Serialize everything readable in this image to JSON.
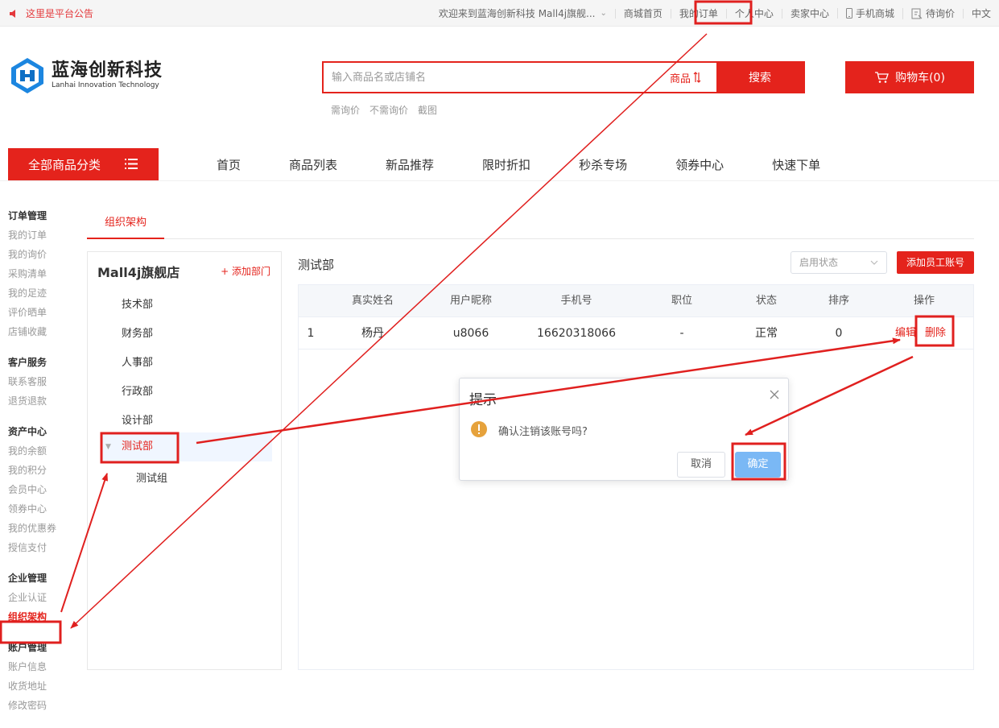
{
  "topbar": {
    "notice": "这里是平台公告",
    "welcome": "欢迎来到蓝海创新科技 Mall4j旗舰...",
    "links": [
      "商城首页",
      "我的订单",
      "个人中心",
      "卖家中心",
      "手机商城",
      "待询价",
      "中文"
    ]
  },
  "logo": {
    "cn": "蓝海创新科技",
    "en": "Lanhai Innovation Technology"
  },
  "search": {
    "placeholder": "输入商品名或店铺名",
    "type": "商品",
    "button": "搜索",
    "hot": [
      "需询价",
      "不需询价",
      "截图"
    ]
  },
  "cart": {
    "label": "购物车(0)"
  },
  "nav": {
    "all_categories": "全部商品分类",
    "items": [
      "首页",
      "商品列表",
      "新品推荐",
      "限时折扣",
      "秒杀专场",
      "领券中心",
      "快速下单"
    ]
  },
  "sidebar": [
    {
      "title": "订单管理",
      "items": [
        "我的订单",
        "我的询价",
        "采购清单",
        "我的足迹",
        "评价晒单",
        "店铺收藏"
      ]
    },
    {
      "title": "客户服务",
      "items": [
        "联系客服",
        "退货退款"
      ]
    },
    {
      "title": "资产中心",
      "items": [
        "我的余额",
        "我的积分",
        "会员中心",
        "领券中心",
        "我的优惠券",
        "授信支付"
      ]
    },
    {
      "title": "企业管理",
      "items": [
        "企业认证",
        "组织架构"
      ]
    },
    {
      "title": "账户管理",
      "items": [
        "账户信息",
        "收货地址",
        "修改密码"
      ]
    }
  ],
  "tabs": [
    "组织架构"
  ],
  "tree": {
    "store": "Mall4j旗舰店",
    "add_dept": "+ 添加部门",
    "nodes": [
      "技术部",
      "财务部",
      "人事部",
      "行政部",
      "设计部",
      "测试部",
      "测试组"
    ]
  },
  "panel": {
    "title": "测试部",
    "status_placeholder": "启用状态",
    "add_account": "添加员工账号",
    "columns": [
      "真实姓名",
      "用户昵称",
      "手机号",
      "职位",
      "状态",
      "排序",
      "操作"
    ],
    "rows": [
      {
        "idx": "1",
        "name": "杨丹",
        "nick": "u8066",
        "phone": "16620318066",
        "position": "-",
        "status": "正常",
        "sort": "0",
        "edit": "编辑",
        "delete": "删除"
      }
    ]
  },
  "dialog": {
    "title": "提示",
    "message": "确认注销该账号吗?",
    "cancel": "取消",
    "ok": "确定"
  },
  "colors": {
    "brand": "#e4231c",
    "annotation": "#e0201f",
    "primary_light": "#7ab8f5",
    "warning": "#e6a23c"
  }
}
